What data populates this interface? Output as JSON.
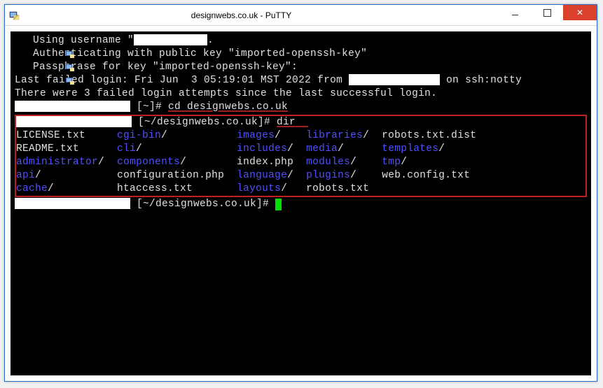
{
  "window": {
    "title": "designwebs.co.uk - PuTTY"
  },
  "lines": {
    "l1_prefix": "Using username \"",
    "l1_suffix": ".",
    "l2": "Authenticating with public key \"imported-openssh-key\"",
    "l3": "Passphrase for key \"imported-openssh-key\":",
    "l4_prefix": "Last failed login: Fri Jun  3 05:19:01 MST 2022 from ",
    "l4_suffix": " on ssh:notty",
    "l5": "There were 3 failed login attempts since the last successful login.",
    "prompt1_suffix": "[~]# ",
    "cmd1": "cd designwebs.co.uk",
    "prompt2_suffix": "[~/designwebs.co.uk]# ",
    "cmd2": "dir",
    "prompt3_suffix": "[~/designwebs.co.uk]# "
  },
  "listing": {
    "row1": {
      "c1": "LICENSE.txt",
      "c2": "cgi-bin",
      "c2s": "/",
      "c3": "images",
      "c3s": "/",
      "c4": "libraries",
      "c4s": "/",
      "c5": "robots.txt.dist"
    },
    "row2": {
      "c1": "README.txt",
      "c2": "cli",
      "c2s": "/",
      "c3": "includes",
      "c3s": "/",
      "c4": "media",
      "c4s": "/",
      "c5": "templates",
      "c5s": "/"
    },
    "row3": {
      "c1": "administrator",
      "c1s": "/",
      "c2": "components",
      "c2s": "/",
      "c3": "index.php",
      "c4": "modules",
      "c4s": "/",
      "c5": "tmp",
      "c5s": "/"
    },
    "row4": {
      "c1": "api",
      "c1s": "/",
      "c2": "configuration.php",
      "c3": "language",
      "c3s": "/",
      "c4": "plugins",
      "c4s": "/",
      "c5": "web.config.txt"
    },
    "row5": {
      "c1": "cache",
      "c1s": "/",
      "c2": "htaccess.txt",
      "c3": "layouts",
      "c3s": "/",
      "c4": "robots.txt"
    }
  }
}
